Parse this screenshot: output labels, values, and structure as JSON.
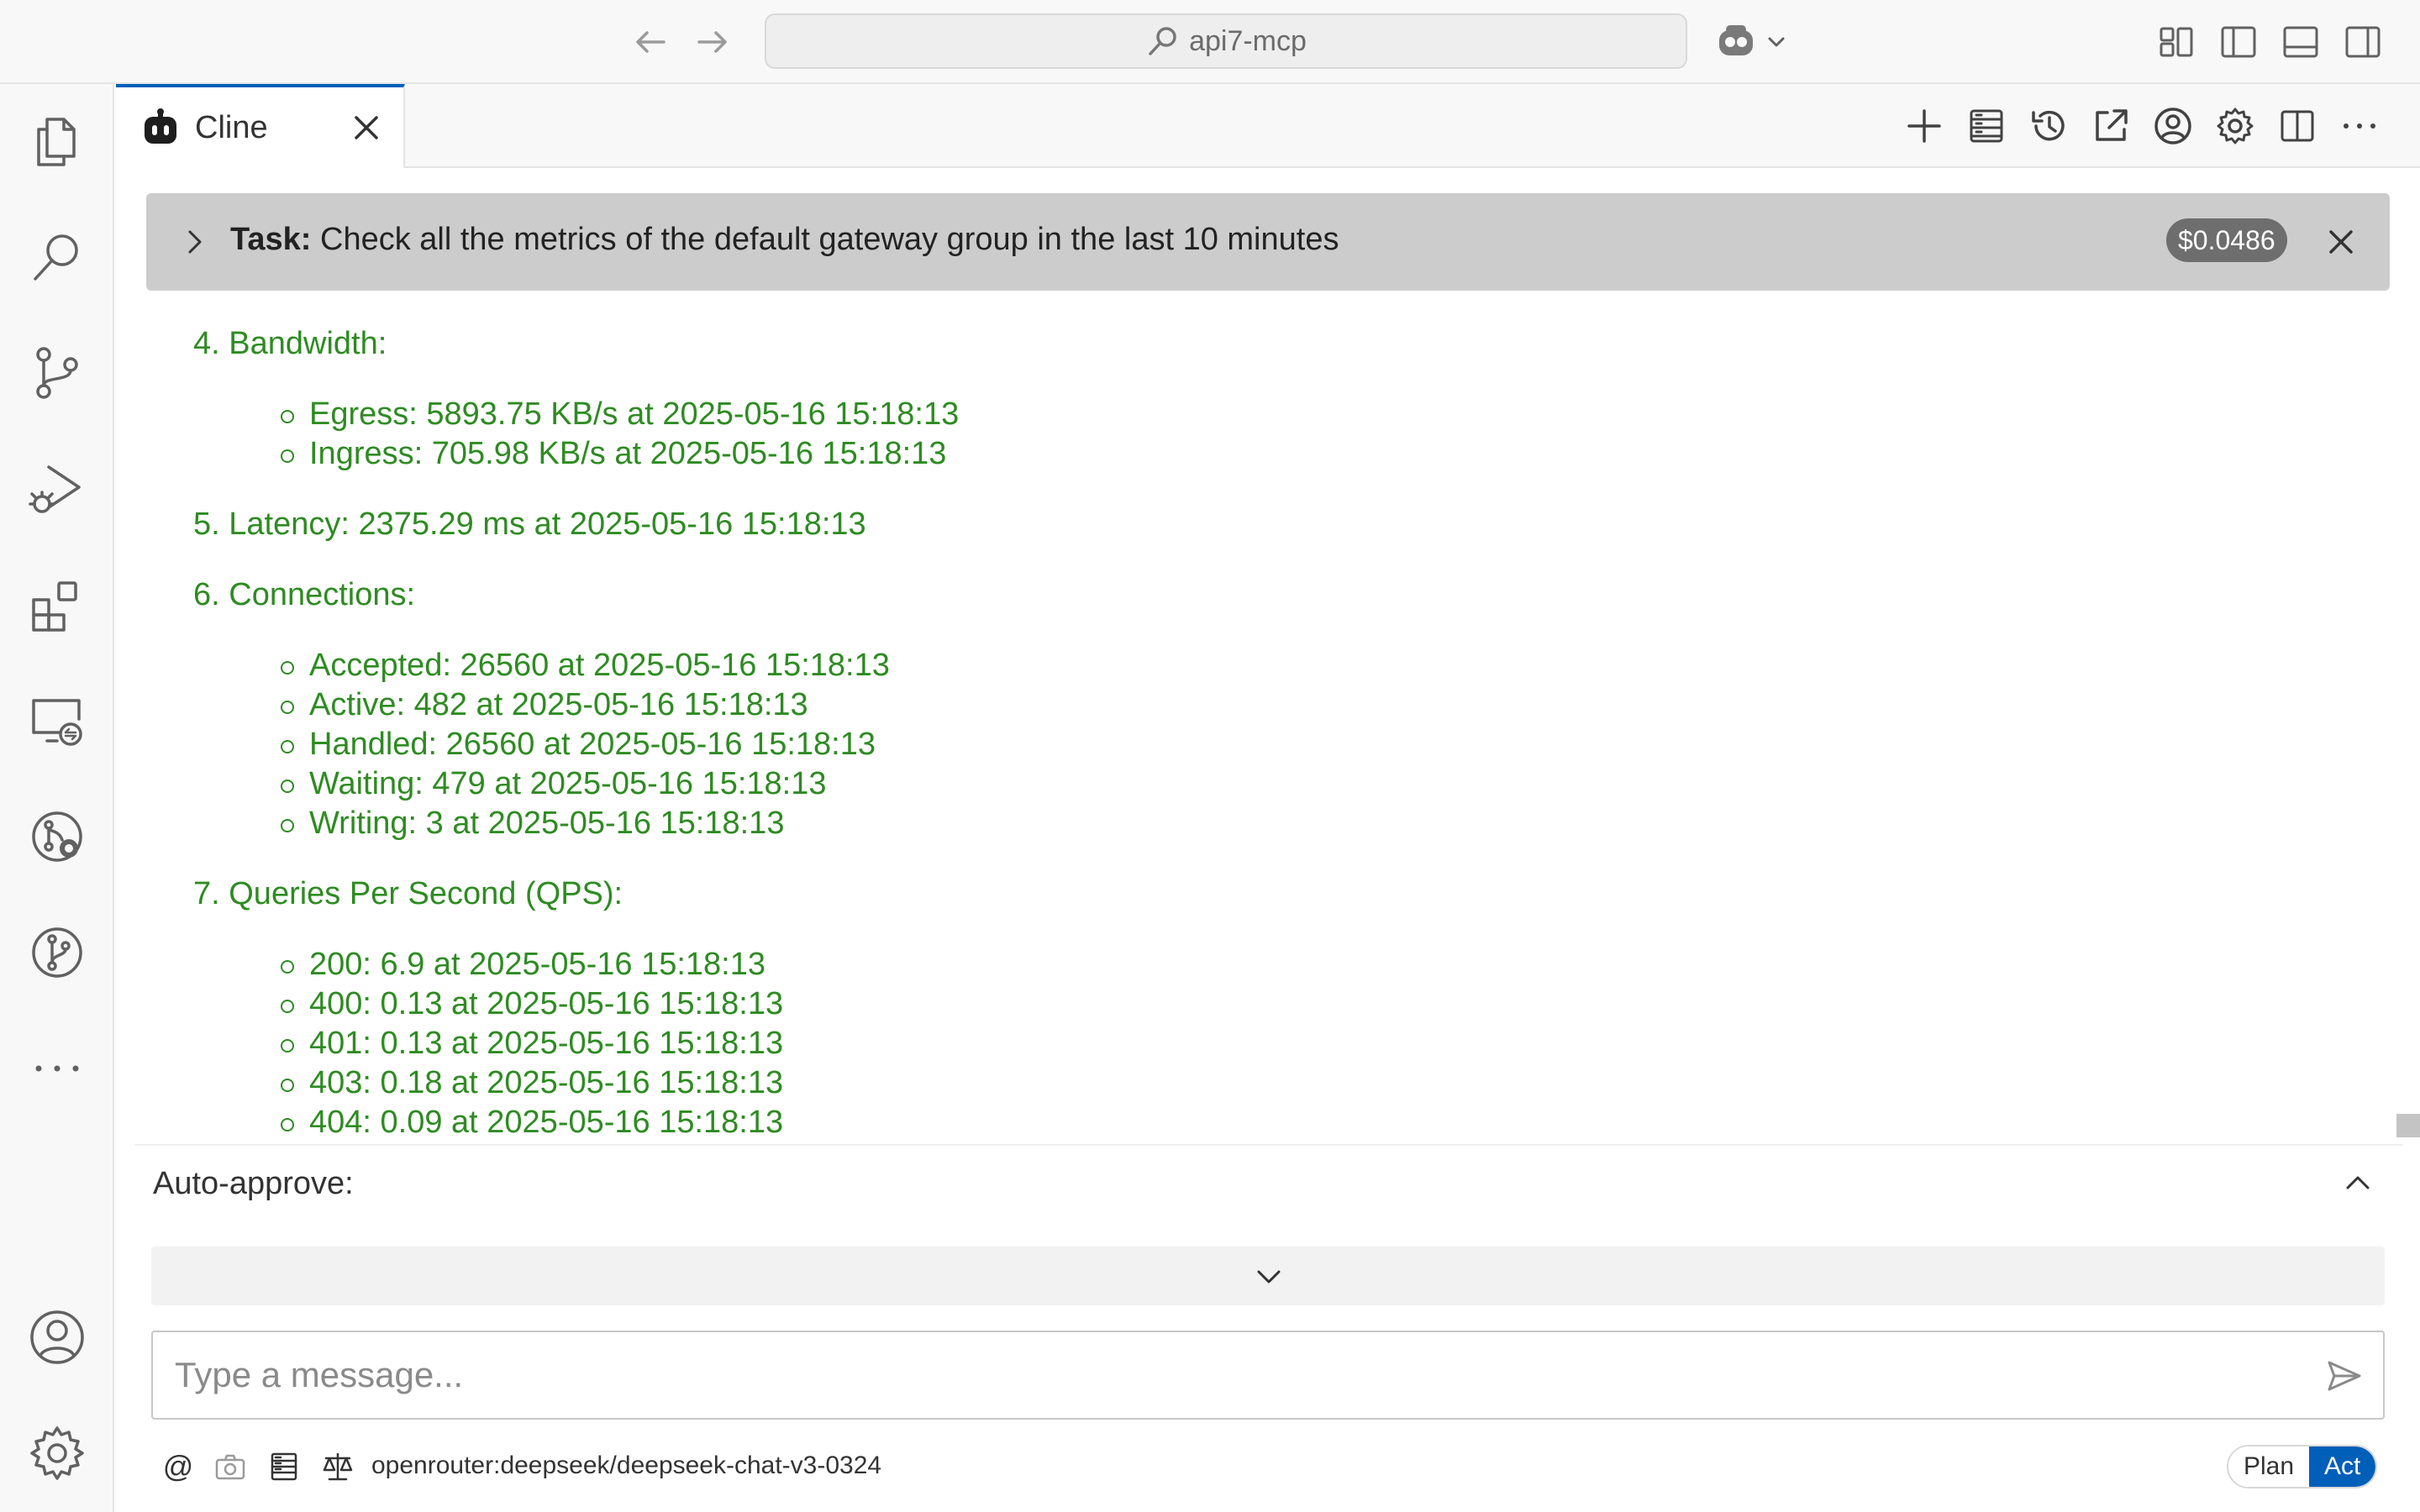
{
  "titlebar": {
    "search_text": "api7-mcp"
  },
  "tab": {
    "label": "Cline"
  },
  "task": {
    "prefix": "Task:",
    "text": "Check all the metrics of the default gateway group in the last 10 minutes",
    "cost": "$0.0486"
  },
  "messages": {
    "bandwidth_heading": "4. Bandwidth:",
    "bandwidth_items": [
      "Egress: 5893.75 KB/s at 2025-05-16 15:18:13",
      "Ingress: 705.98 KB/s at 2025-05-16 15:18:13"
    ],
    "latency_heading": "5. Latency: 2375.29 ms at 2025-05-16 15:18:13",
    "connections_heading": "6. Connections:",
    "connections_items": [
      "Accepted: 26560 at 2025-05-16 15:18:13",
      "Active: 482 at 2025-05-16 15:18:13",
      "Handled: 26560 at 2025-05-16 15:18:13",
      "Waiting: 479 at 2025-05-16 15:18:13",
      "Writing: 3 at 2025-05-16 15:18:13"
    ],
    "qps_heading": "7. Queries Per Second (QPS):",
    "qps_items": [
      "200: 6.9 at 2025-05-16 15:18:13",
      "400: 0.13 at 2025-05-16 15:18:13",
      "401: 0.13 at 2025-05-16 15:18:13",
      "403: 0.18 at 2025-05-16 15:18:13",
      "404: 0.09 at 2025-05-16 15:18:13"
    ],
    "text_color": "#2e8b22"
  },
  "auto_approve": {
    "label": "Auto-approve:"
  },
  "input": {
    "placeholder": "Type a message...",
    "value": ""
  },
  "bottom": {
    "mention_label": "@",
    "model": "openrouter:deepseek/deepseek-chat-v3-0324",
    "mode_plan": "Plan",
    "mode_act": "Act"
  },
  "colors": {
    "accent": "#005fb8",
    "task_header_bg": "#cccccc",
    "cost_badge_bg": "#6e6e6e"
  }
}
